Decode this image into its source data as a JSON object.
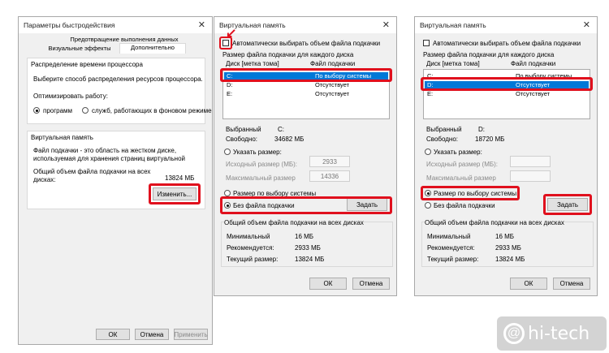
{
  "left": {
    "title": "Параметры быстродействия",
    "tabs": [
      "Предотвращение выполнения данных",
      "Визуальные эффекты",
      "Дополнительно"
    ],
    "cpu_group": "Распределение времени процессора",
    "cpu_desc": "Выберите способ распределения ресурсов процессора.",
    "optimize_label": "Оптимизировать работу:",
    "radio_programs": "программ",
    "radio_services": "служб, работающих в фоновом режиме",
    "vm_group": "Виртуальная память",
    "vm_desc1": "Файл подкачки - это область на жестком диске,",
    "vm_desc2": "используемая для хранения страниц виртуальной",
    "total_label1": "Общий объем файла подкачки на всех",
    "total_label2": "дисках:",
    "total_value": "13824 МБ",
    "change_button": "Изменить...",
    "ok": "ОК",
    "cancel": "Отмена",
    "apply": "Применить"
  },
  "mid": {
    "title": "Виртуальная память",
    "auto_label": "Автоматически выбирать объем файла подкачки",
    "disk_group": "Размер файла подкачки для каждого диска",
    "col_disk": "Диск [метка тома]",
    "col_file": "Файл подкачки",
    "rows": [
      {
        "disk": "C:",
        "file": "По выбору системы"
      },
      {
        "disk": "D:",
        "file": "Отсутствует"
      },
      {
        "disk": "E:",
        "file": "Отсутствует"
      }
    ],
    "selected_label": "Выбранный",
    "selected_value": "C:",
    "free_label": "Свободно:",
    "free_value": "34682 МБ",
    "custom_size": "Указать размер:",
    "initial_label": "Исходный размер (МБ):",
    "initial_value": "2933",
    "max_label": "Максимальный размер",
    "max_value": "14336",
    "system_size": "Размер по выбору системы",
    "no_file": "Без файла подкачки",
    "set_button": "Задать",
    "total_group": "Общий объем файла подкачки на всех дисках",
    "min_label": "Минимальный",
    "min_value": "16 МБ",
    "rec_label": "Рекомендуется:",
    "rec_value": "2933 МБ",
    "cur_label": "Текущий размер:",
    "cur_value": "13824 МБ",
    "ok": "ОК",
    "cancel": "Отмена"
  },
  "right": {
    "title": "Виртуальная память",
    "auto_label": "Автоматически выбирать объем файла подкачки",
    "disk_group": "Размер файла подкачки для каждого диска",
    "col_disk": "Диск [метка тома]",
    "col_file": "Файл подкачки",
    "rows": [
      {
        "disk": "C:",
        "file": "По выбору системы"
      },
      {
        "disk": "D:",
        "file": "Отсутствует"
      },
      {
        "disk": "E:",
        "file": "Отсутствует"
      }
    ],
    "selected_label": "Выбранный",
    "selected_value": "D:",
    "free_label": "Свободно:",
    "free_value": "18720 МБ",
    "custom_size": "Указать размер:",
    "initial_label": "Исходный размер (МБ):",
    "max_label": "Максимальный размер",
    "system_size": "Размер по выбору системы",
    "no_file": "Без файла подкачки",
    "set_button": "Задать",
    "total_group": "Общий объем файла подкачки на всех дисках",
    "min_label": "Минимальный",
    "min_value": "16 МБ",
    "rec_label": "Рекомендуется:",
    "rec_value": "2933 МБ",
    "cur_label": "Текущий размер:",
    "cur_value": "13824 МБ",
    "ok": "ОК",
    "cancel": "Отмена"
  },
  "watermark": {
    "text": "hi-tech"
  },
  "colors": {
    "highlight": "#e0101d",
    "selection": "#0078d7"
  }
}
